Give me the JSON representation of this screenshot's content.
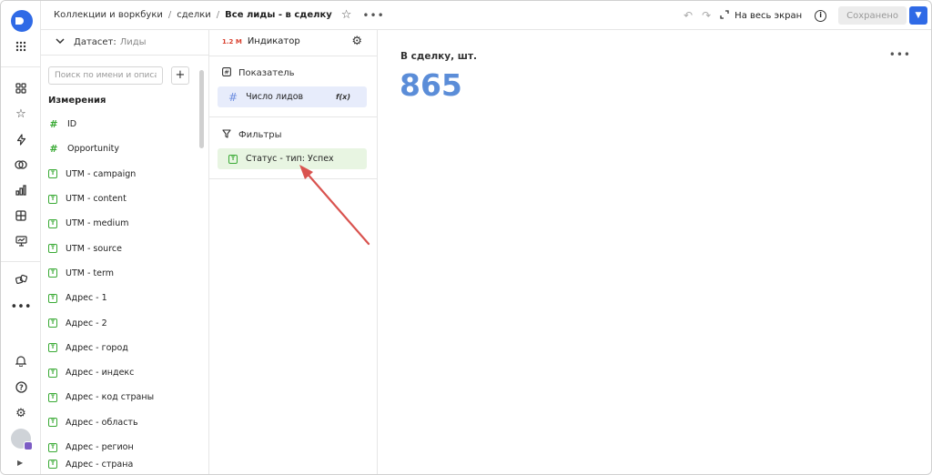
{
  "header": {
    "breadcrumb": [
      "Коллекции и воркбуки",
      "сделки",
      "Все лиды - в сделку"
    ],
    "breadcrumb_sep": "/",
    "fullscreen_label": "На весь экран",
    "saved_label": "Сохранено"
  },
  "dataset": {
    "label": "Датасет:",
    "name": "Лиды",
    "search_placeholder": "Поиск по имени и описанию",
    "add_label": "+",
    "section_title": "Измерения",
    "fields": [
      {
        "label": "ID",
        "type": "number"
      },
      {
        "label": "Opportunity",
        "type": "number"
      },
      {
        "label": "UTM - campaign",
        "type": "text"
      },
      {
        "label": "UTM - content",
        "type": "text"
      },
      {
        "label": "UTM - medium",
        "type": "text"
      },
      {
        "label": "UTM - source",
        "type": "text"
      },
      {
        "label": "UTM - term",
        "type": "text"
      },
      {
        "label": "Адрес - 1",
        "type": "text"
      },
      {
        "label": "Адрес - 2",
        "type": "text"
      },
      {
        "label": "Адрес - город",
        "type": "text"
      },
      {
        "label": "Адрес - индекс",
        "type": "text"
      },
      {
        "label": "Адрес - код страны",
        "type": "text"
      },
      {
        "label": "Адрес - область",
        "type": "text"
      },
      {
        "label": "Адрес - регион",
        "type": "text"
      },
      {
        "label": "Адрес - страна",
        "type": "text"
      }
    ]
  },
  "config": {
    "viz_icon_text": "1.2 M",
    "viz_label": "Индикатор",
    "measure_section": "Показатель",
    "measure_item": "Число лидов",
    "measure_fx": "f(x)",
    "filter_section": "Фильтры",
    "filter_item": "Статус - тип: Успех"
  },
  "preview": {
    "title": "В сделку, шт.",
    "value": "865"
  },
  "colors": {
    "accent": "#2f6ae6",
    "value_color": "#5b8dd8",
    "field_icon": "#3aaa35",
    "arrow": "#d9534f"
  }
}
